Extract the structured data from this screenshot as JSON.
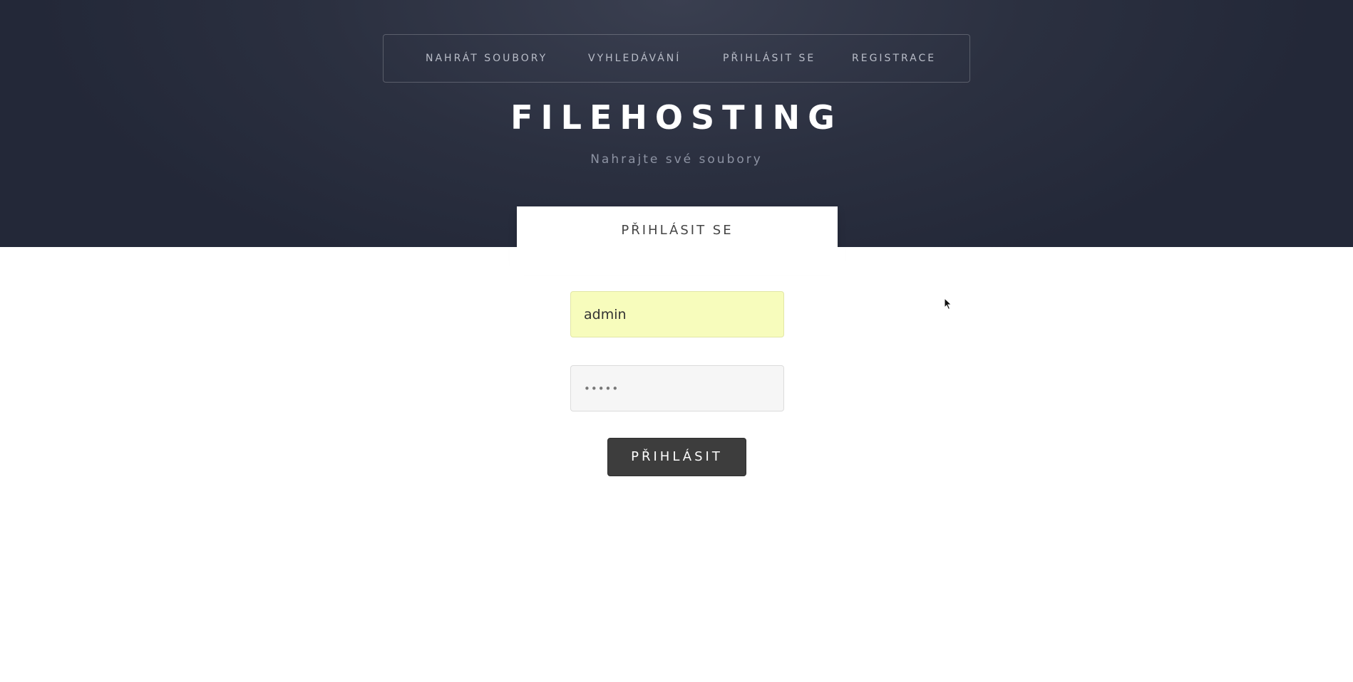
{
  "nav": {
    "items": [
      {
        "label": "NAHRÁT SOUBORY"
      },
      {
        "label": "VYHLEDÁVÁNÍ"
      },
      {
        "label": "PŘIHLÁSIT SE"
      },
      {
        "label": "REGISTRACE"
      }
    ]
  },
  "header": {
    "logo": "FILEHOSTING",
    "subtitle": "Nahrajte své soubory"
  },
  "login": {
    "title": "PŘIHLÁSIT SE",
    "username_value": "admin",
    "password_value": "•••••",
    "submit_label": "PŘIHLÁSIT"
  },
  "colors": {
    "header_bg": "#2b3040",
    "autofill_bg": "#f7fcbc",
    "button_bg": "#3d3d3d"
  },
  "icons": {
    "cursor": "mouse-pointer-icon"
  }
}
